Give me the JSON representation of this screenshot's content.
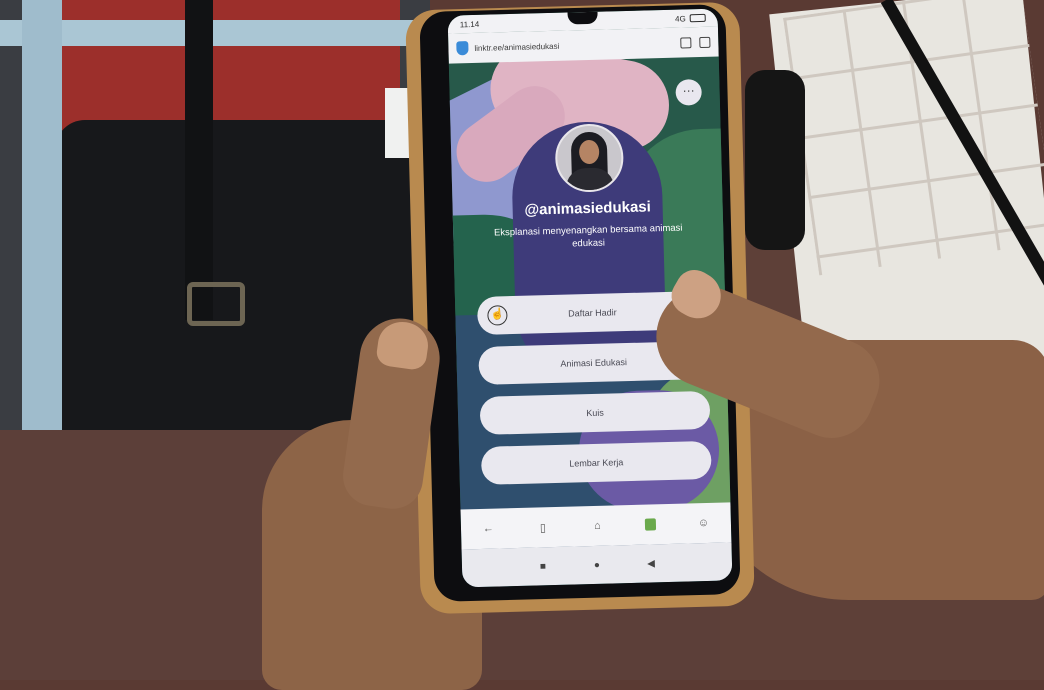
{
  "status_bar": {
    "time": "11.14",
    "network": "4G",
    "battery": "battery-icon"
  },
  "browser": {
    "url": "linktr.ee/animasiedukasi",
    "icons": [
      "shield-icon",
      "share-icon",
      "tabs-icon"
    ]
  },
  "profile": {
    "handle": "@animasiedukasi",
    "bio": "Eksplanasi menyenangkan bersama animasi edukasi",
    "menu_glyph": "···"
  },
  "links": [
    {
      "label": "Daftar Hadir",
      "icon": "thumb-icon"
    },
    {
      "label": "Animasi Edukasi"
    },
    {
      "label": "Kuis"
    },
    {
      "label": "Lembar Kerja"
    }
  ],
  "browser_nav": {
    "back": "←",
    "bookmarks": "▯",
    "home": "⌂",
    "tabs": "tabs-icon",
    "profile": "☺"
  },
  "system_nav": {
    "recent": "■",
    "home": "●",
    "back": "◀"
  },
  "colors": {
    "button_bg": "#e9e8ef",
    "handle_text": "#ffffff",
    "accent_green": "#27594a",
    "accent_lilac": "#8f98cf"
  }
}
